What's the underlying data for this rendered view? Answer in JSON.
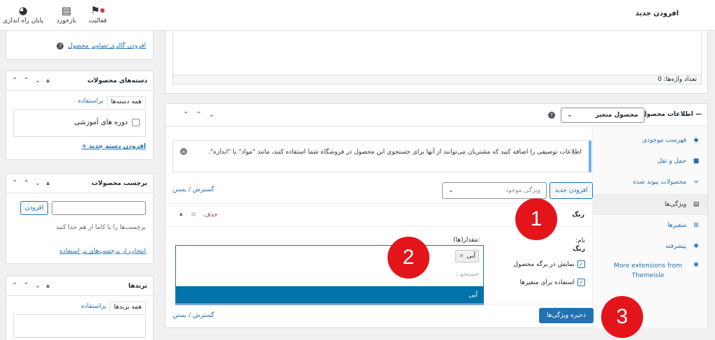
{
  "topbar": {
    "title": "افزودن جدید",
    "items": [
      {
        "icon": "finish-setup-icon",
        "label": "پایان راه اندازی"
      },
      {
        "icon": "feedback-icon",
        "label": "بازخورد"
      },
      {
        "icon": "activity-flag-icon",
        "label": "فعالیت"
      }
    ]
  },
  "editor": {
    "word_count": "تعداد واژه‌ها: 0"
  },
  "gallery": {
    "link": "افزودن گالری تصاویر محصول",
    "help": "?"
  },
  "categories": {
    "title": "دسته‌های محصولات",
    "tab_all": "همه دسته‌ها",
    "tab_popular": "پراستفاده",
    "item": "دوره های آموزشی",
    "add_link": "+ افزودن دسته جدید"
  },
  "tags": {
    "title": "برچسب محصولات",
    "add_button": "افزودن",
    "help": "برچسب‌ها را با کاما از هم جدا کنید",
    "choose_link": "انتخاب از برچسب‌های پر استفاده"
  },
  "brands": {
    "title": "برندها",
    "tab_all": "همه برندها",
    "tab_popular": "پراستفاده"
  },
  "product_data": {
    "title": "اطلاعات محصول —",
    "type_select": "محصول متغیر",
    "help": "?",
    "notice": "اطلاعات توصیفی را اضافه کنید که مشتریان می‌توانند از آنها برای جستجوی این محصول در فروشگاه شما استفاده کنند، مانند \"مواد\" یا \"اندازه\".",
    "add_new_button": "افزودن جدید",
    "existing_attr_placeholder": "ویژگی موجود",
    "expand_close": "گسترش / بستن",
    "attribute": {
      "name": "رنگ",
      "remove": "حذف",
      "name_label": "نام:",
      "name_value": "رنگ",
      "values_label": "مقدار(ها):",
      "token": "آبی",
      "search_placeholder": "جستجو ;",
      "highlighted_option": "آبی",
      "visible_on_page": "نمایش در برگه محصول",
      "used_for_variations": "استفاده برای متغیرها"
    },
    "save_button": "ذخیره ویژگی‌ها",
    "expand_close_bottom": "گسترش / بستن"
  },
  "side_tabs": [
    {
      "icon": "inventory-icon",
      "label": "فهرست موجودی"
    },
    {
      "icon": "shipping-truck-icon",
      "label": "حمل و نقل"
    },
    {
      "icon": "link-icon",
      "label": "محصولات پیوند شده"
    },
    {
      "icon": "attributes-icon",
      "label": "ویژگی‌ها"
    },
    {
      "icon": "variations-grid-icon",
      "label": "متغیرها"
    },
    {
      "icon": "advanced-gear-icon",
      "label": "پیشرفته"
    },
    {
      "icon": "extensions-icon",
      "label": "More extensions from Themeisle"
    }
  ],
  "badges": [
    "1",
    "2",
    "3"
  ]
}
